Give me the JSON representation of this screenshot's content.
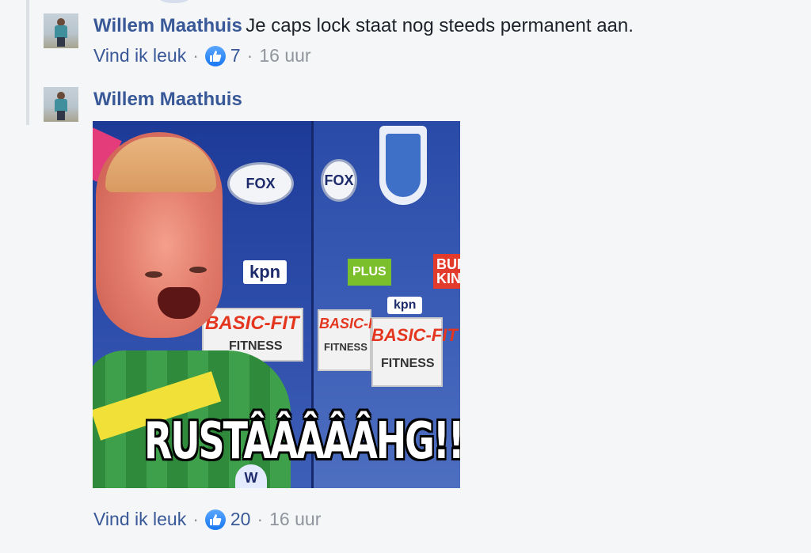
{
  "comments": [
    {
      "author": "Willem Maathuis",
      "text": "Je caps lock staat nog steeds permanent aan.",
      "like_label": "Vind ik leuk",
      "reaction_count": "7",
      "time": "16 uur"
    },
    {
      "author": "Willem Maathuis",
      "gif": {
        "caption": "RUSTÂÂÂÂÂHG!!",
        "board_texts": {
          "fox_1": "FOX",
          "fox_2": "FOX",
          "kpn_1": "kpn",
          "kpn_2": "kpn",
          "plus": "PLUS",
          "burger": "BUR KIN",
          "basic_fit_1": "BASIC-FIT",
          "basic_fit_2": "BASIC-FIT",
          "basic_fit_3": "BASIC-FIT",
          "fitness_1": "FITNESS",
          "fitness_2": "FITNESS",
          "fitness_3": "FITNESS",
          "shirt_badge": "W"
        }
      },
      "like_label": "Vind ik leuk",
      "reaction_count": "20",
      "time": "16 uur"
    }
  ],
  "separator": "·",
  "colors": {
    "author": "#385898",
    "like_icon": "#1877f2",
    "meta": "#90949c",
    "text": "#1d2129",
    "background": "#f5f6f7"
  },
  "icons": {
    "like": "thumbs-up-icon"
  }
}
